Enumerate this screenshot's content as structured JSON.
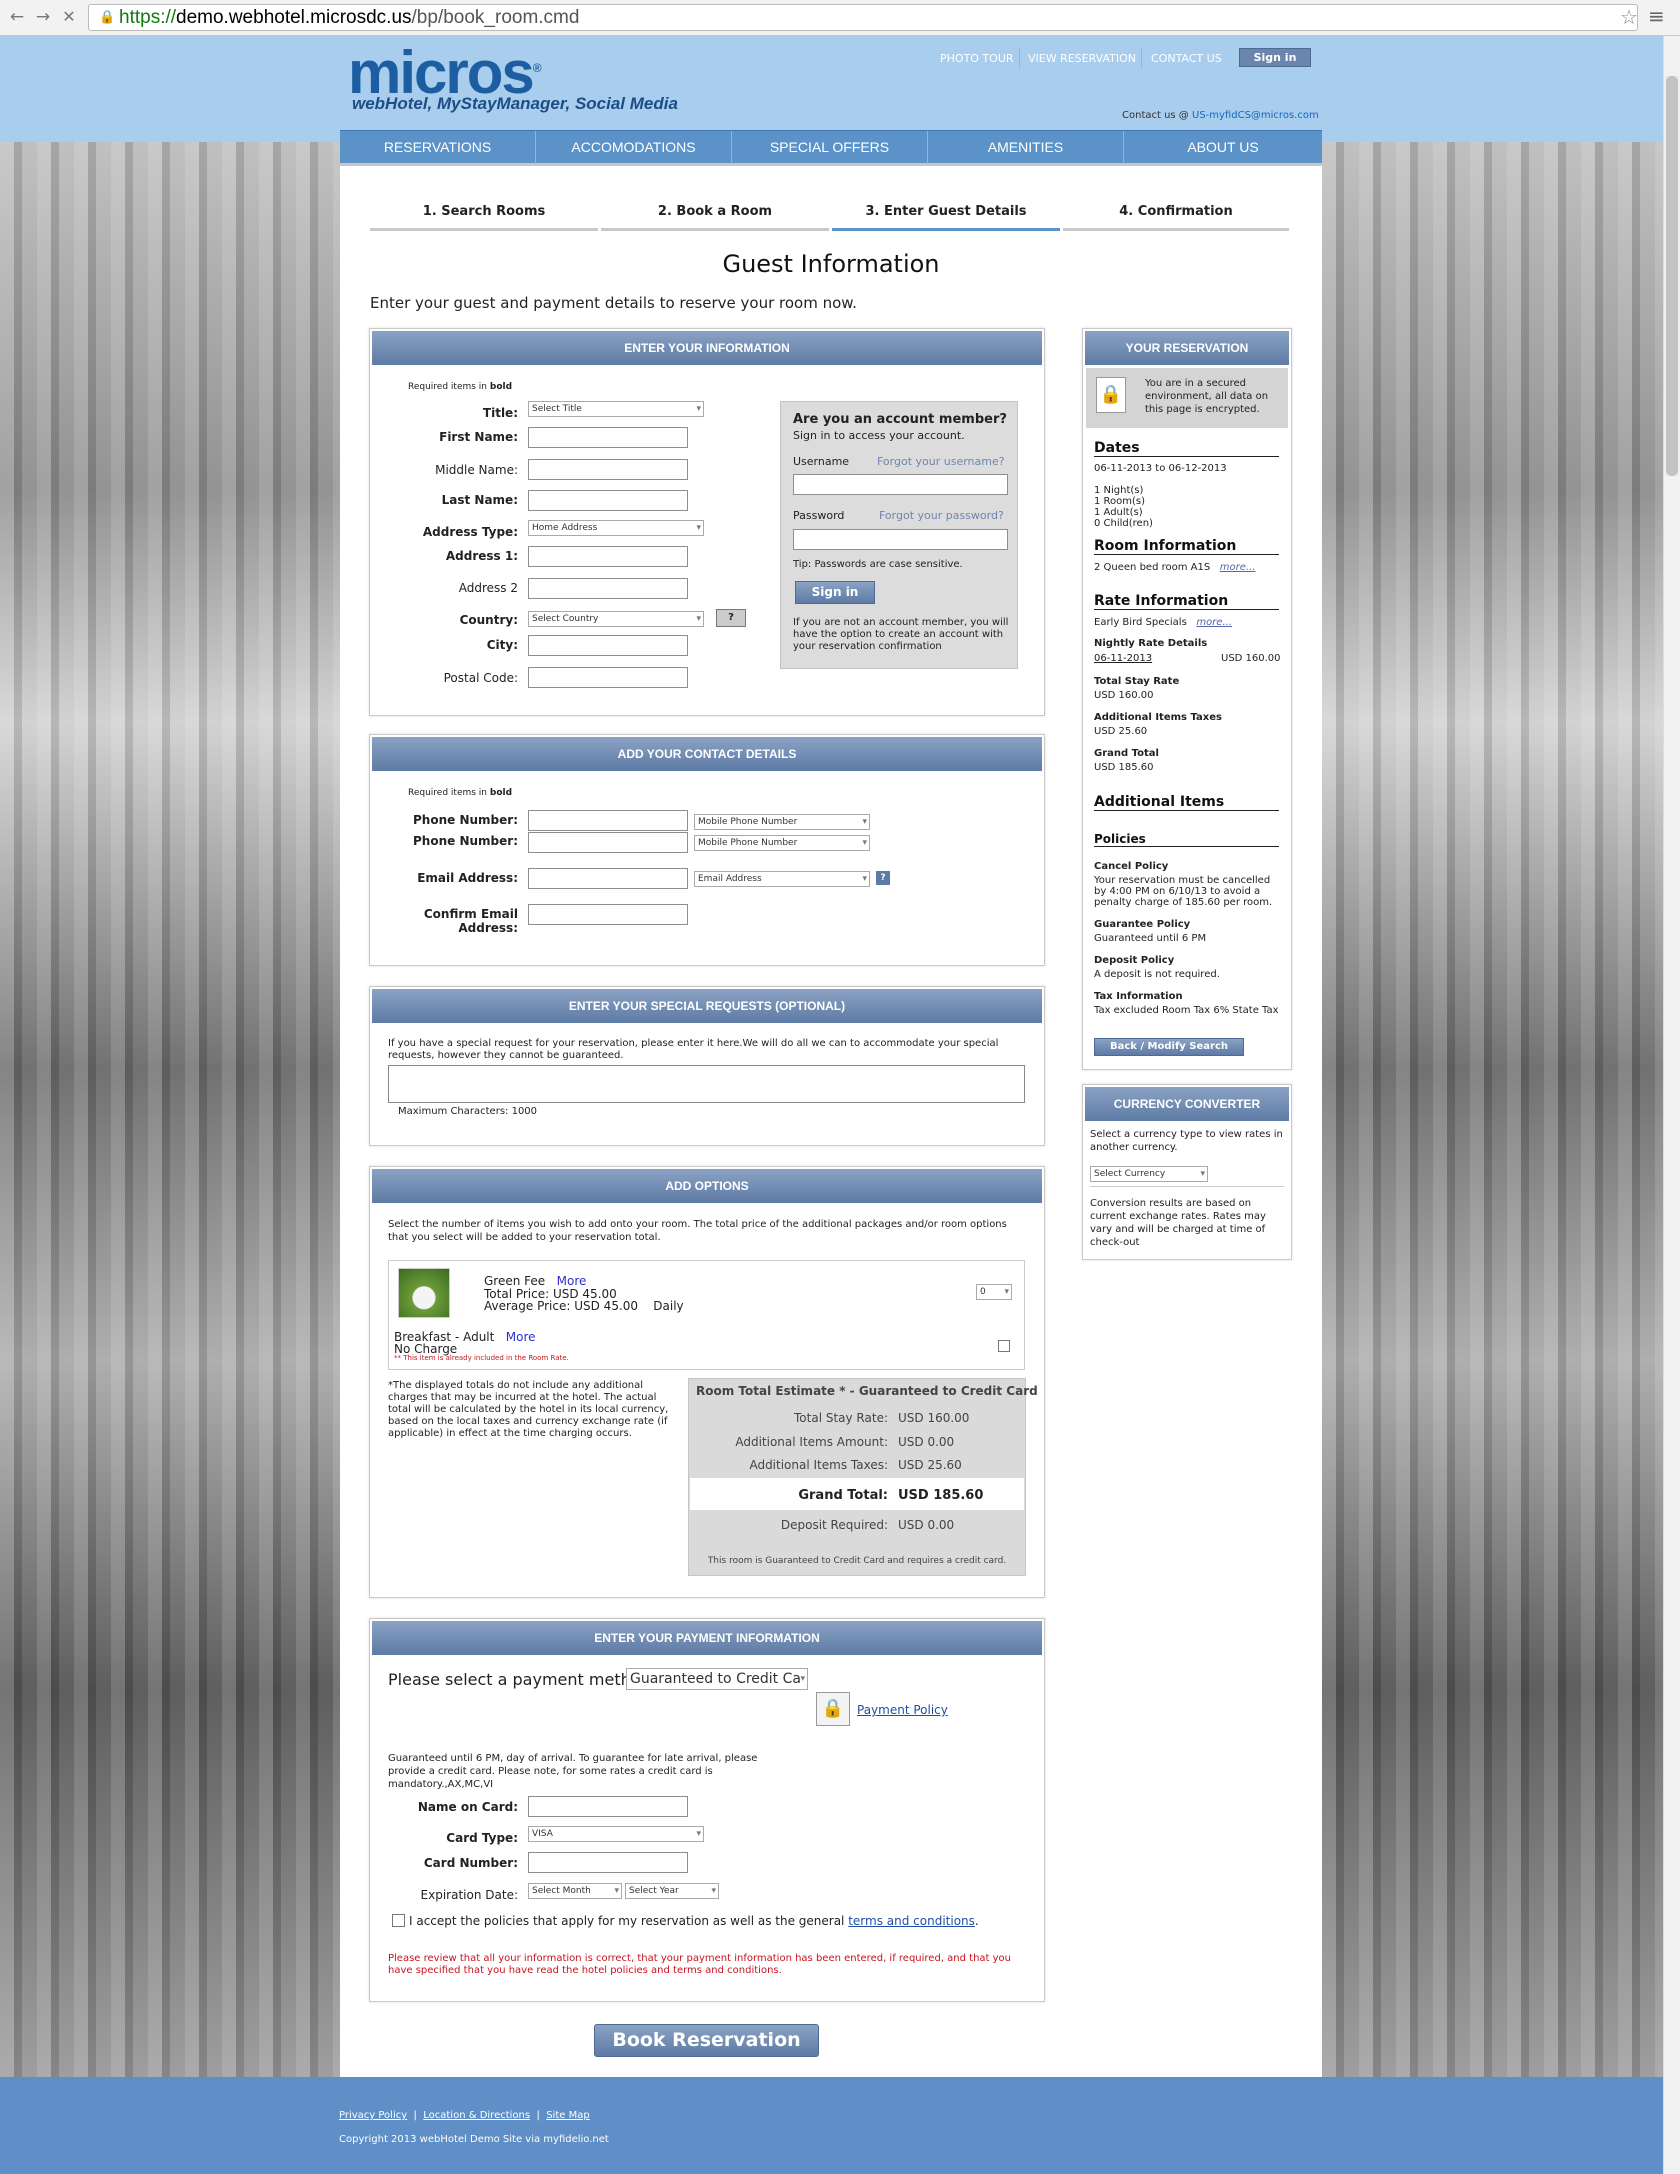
{
  "browser": {
    "url_scheme": "https://",
    "url_host": "demo.webhotel.microsdc.us",
    "url_path": "/bp/book_room.cmd"
  },
  "header": {
    "logo": "micros",
    "logo_mark": "®",
    "tagline": "webHotel, MyStayManager, Social Media",
    "top_links": [
      "PHOTO TOUR",
      "VIEW RESERVATION",
      "CONTACT US"
    ],
    "signin_label": "Sign in",
    "contact_prefix": "Contact us @",
    "contact_email": "US-myfidCS@micros.com"
  },
  "nav": [
    "RESERVATIONS",
    "ACCOMODATIONS",
    "SPECIAL OFFERS",
    "AMENITIES",
    "ABOUT US"
  ],
  "steps": [
    "1. Search Rooms",
    "2. Book a Room",
    "3. Enter Guest Details",
    "4. Confirmation"
  ],
  "active_step": 3,
  "page_title": "Guest Information",
  "intro": "Enter your guest and payment details to reserve your room now.",
  "info_panel": {
    "title": "ENTER YOUR INFORMATION",
    "required_prefix": "Required items in ",
    "required_bold": "bold",
    "labels": {
      "title": "Title:",
      "first_name": "First Name:",
      "middle_name": "Middle Name:",
      "last_name": "Last Name:",
      "address_type": "Address Type:",
      "address1": "Address 1:",
      "address2": "Address 2",
      "country": "Country:",
      "city": "City:",
      "postal": "Postal Code:"
    },
    "title_select": "Select Title",
    "address_type_select": "Home Address",
    "country_select": "Select Country",
    "help": "?"
  },
  "member_box": {
    "heading": "Are you an account member?",
    "sub": "Sign in to access your account.",
    "username_label": "Username",
    "forgot_username": "Forgot your username?",
    "password_label": "Password",
    "forgot_password": "Forgot your password?",
    "tip": "Tip: Passwords are case sensitive.",
    "signin": "Sign in",
    "note": "If you are not an account member, you will have the option to create an account with your reservation confirmation"
  },
  "contact_panel": {
    "title": "ADD YOUR CONTACT DETAILS",
    "required_prefix": "Required items in ",
    "required_bold": "bold",
    "phone_label": "Phone Number:",
    "phone_type": "Mobile Phone Number",
    "email_label": "Email Address:",
    "email_type": "Email Address",
    "confirm_email_label_1": "Confirm Email",
    "confirm_email_label_2": "Address:",
    "help": "?"
  },
  "requests_panel": {
    "title": "ENTER YOUR SPECIAL REQUESTS (OPTIONAL)",
    "text": "If you have a special request for your reservation, please enter it here.We will do all we can to accommodate your special requests, however they cannot be guaranteed.",
    "max": "Maximum Characters: 1000"
  },
  "options_panel": {
    "title": "ADD OPTIONS",
    "text": "Select the number of items you wish to add onto your room. The total price of the additional packages and/or room options that you select will be added to your reservation total.",
    "item1": {
      "name": "Green Fee",
      "more": "More",
      "total": "Total Price: USD 45.00",
      "avg": "Average Price: USD 45.00",
      "freq": "Daily",
      "qty": "0"
    },
    "item2": {
      "name": "Breakfast - Adult",
      "more": "More",
      "charge": "No Charge",
      "note": "** This item is already included in the Room Rate."
    },
    "disclaimer": "*The displayed totals do not include any additional charges that may be incurred at the hotel. The actual total will be calculated by the hotel in its local currency, based on the local taxes and currency exchange rate (if applicable) in effect at the time charging occurs."
  },
  "estimate": {
    "title": "Room Total Estimate * - Guaranteed to Credit Card",
    "rows": [
      {
        "label": "Total Stay Rate:",
        "value": "USD 160.00"
      },
      {
        "label": "Additional Items Amount:",
        "value": "USD 0.00"
      },
      {
        "label": "Additional Items Taxes:",
        "value": "USD 25.60"
      }
    ],
    "grand_label": "Grand Total:",
    "grand_value": "USD 185.60",
    "deposit_label": "Deposit Required:",
    "deposit_value": "USD 0.00",
    "note": "This room is Guaranteed to Credit Card and requires a credit card."
  },
  "payment_panel": {
    "title": "ENTER YOUR PAYMENT INFORMATION",
    "method_label": "Please select a payment method:",
    "method_value": "Guaranteed to Credit Ca",
    "policy_link": "Payment Policy",
    "guarantee_text": "Guaranteed until 6 PM, day of arrival. To guarantee for late arrival, please provide a credit card. Please note, for some rates a credit card is mandatory.,AX,MC,VI",
    "name_label": "Name on Card:",
    "type_label": "Card Type:",
    "type_value": "VISA",
    "number_label": "Card Number:",
    "exp_label": "Expiration Date:",
    "exp_month": "Select Month",
    "exp_year": "Select Year",
    "accept_text": "I accept the policies that apply for my reservation as well as the general ",
    "terms_link": "terms and conditions",
    "accept_end": ".",
    "warning": "Please review that all your information is correct, that your payment information has been entered, if required, and that you have specified that you have read the hotel policies and terms and conditions."
  },
  "book_button": "Book Reservation",
  "reservation": {
    "title": "YOUR RESERVATION",
    "secure": "You are in a secured environment, all data on this page is encrypted.",
    "dates_h": "Dates",
    "dates": "06-11-2013  to  06-12-2013",
    "nights": "1 Night(s)",
    "rooms": "1 Room(s)",
    "adults": "1 Adult(s)",
    "children": "0 Child(ren)",
    "room_h": "Room Information",
    "room": "2 Queen bed room A1S",
    "more": "more...",
    "rate_h": "Rate Information",
    "rate": "Early Bird Specials",
    "nightly_h": "Nightly Rate Details",
    "nightly_date": "06-11-2013",
    "nightly_value": "USD 160.00",
    "total_stay_h": "Total Stay Rate",
    "total_stay": "USD 160.00",
    "taxes_h": "Additional Items Taxes",
    "taxes": "USD 25.60",
    "grand_h": "Grand Total",
    "grand": "USD 185.60",
    "addl_h": "Additional Items",
    "policies_h": "Policies",
    "cancel_h": "Cancel Policy",
    "cancel": "Your reservation must be cancelled by 4:00 PM on 6/10/13 to avoid a penalty charge of 185.60 per room.",
    "guarantee_h": "Guarantee Policy",
    "guarantee": "Guaranteed until 6 PM",
    "deposit_h": "Deposit Policy",
    "deposit": "A deposit is not required.",
    "tax_h": "Tax Information",
    "tax": "Tax excluded Room Tax 6% State Tax",
    "back_btn": "Back / Modify Search"
  },
  "currency": {
    "title": "CURRENCY CONVERTER",
    "text": "Select a currency type to view rates in another currency.",
    "select": "Select Currency",
    "note": "Conversion results are based on current exchange rates. Rates may vary and will be charged at time of check-out"
  },
  "footer": {
    "links": [
      "Privacy Policy",
      "Location & Directions",
      "Site Map"
    ],
    "copyright": "Copyright 2013  webHotel Demo Site via myfidelio.net"
  }
}
